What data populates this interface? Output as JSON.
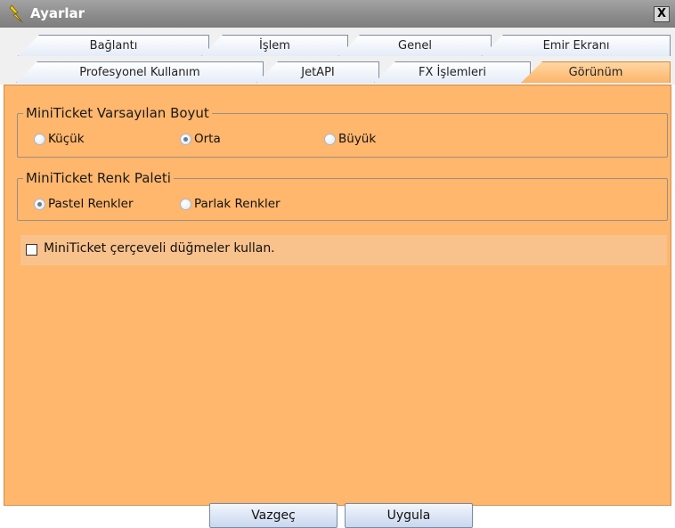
{
  "window": {
    "title": "Ayarlar",
    "close_symbol": "X",
    "icon": "lightning-icon"
  },
  "tabs": {
    "row1": [
      {
        "label": "Bağlantı"
      },
      {
        "label": "İşlem"
      },
      {
        "label": "Genel"
      },
      {
        "label": "Emir Ekranı"
      }
    ],
    "row2": [
      {
        "label": "Profesyonel Kullanım"
      },
      {
        "label": "JetAPI"
      },
      {
        "label": "FX İşlemleri"
      },
      {
        "label": "Görünüm",
        "active": true
      }
    ]
  },
  "size_group": {
    "title": "MiniTicket Varsayılan Boyut",
    "options": [
      {
        "label": "Küçük",
        "checked": false
      },
      {
        "label": "Orta",
        "checked": true
      },
      {
        "label": "Büyük",
        "checked": false
      }
    ]
  },
  "palette_group": {
    "title": "MiniTicket Renk Paleti",
    "options": [
      {
        "label": "Pastel Renkler",
        "checked": true
      },
      {
        "label": "Parlak Renkler",
        "checked": false
      }
    ]
  },
  "framed_buttons": {
    "label": "MiniTicket çerçeveli düğmeler kullan.",
    "checked": false
  },
  "buttons": {
    "cancel": "Vazgeç",
    "apply": "Uygula"
  },
  "colors": {
    "panel_bg": "#ffb66d",
    "active_tab": "#fcb56a",
    "title_bar": "#8a8a8a"
  }
}
